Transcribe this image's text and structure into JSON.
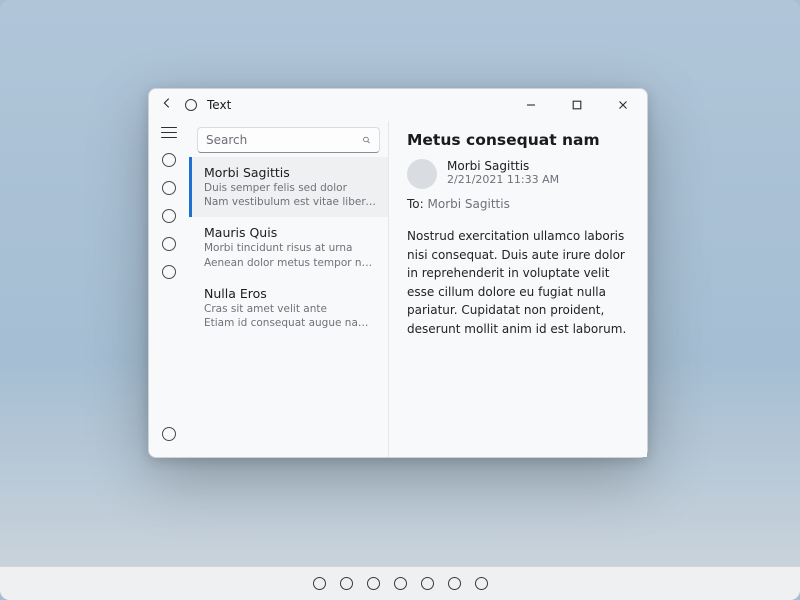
{
  "titlebar": {
    "title": "Text"
  },
  "search": {
    "placeholder": "Search"
  },
  "list": {
    "items": [
      {
        "title": "Morbi Sagittis",
        "line1": "Duis semper felis sed dolor",
        "line2": "Nam vestibulum est vitae libero finibus et"
      },
      {
        "title": "Mauris Quis",
        "line1": "Morbi tincidunt risus at urna",
        "line2": "Aenean dolor metus tempor nulla ac dapibus"
      },
      {
        "title": "Nulla Eros",
        "line1": "Cras sit amet velit ante",
        "line2": "Etiam id consequat augue nam tincidunt"
      }
    ],
    "selected_index": 0
  },
  "detail": {
    "subject": "Metus consequat nam",
    "sender_name": "Morbi Sagittis",
    "sender_time": "2/21/2021 11:33 AM",
    "to_label": "To:",
    "to_value": "Morbi Sagittis",
    "body": "Nostrud exercitation ullamco laboris nisi consequat. Duis aute irure dolor in reprehenderit in voluptate velit esse cillum dolore eu fugiat nulla pariatur. Cupidatat non proident, deserunt mollit anim id est laborum."
  },
  "rail": {
    "item_count": 5
  },
  "taskbar": {
    "item_count": 7
  }
}
